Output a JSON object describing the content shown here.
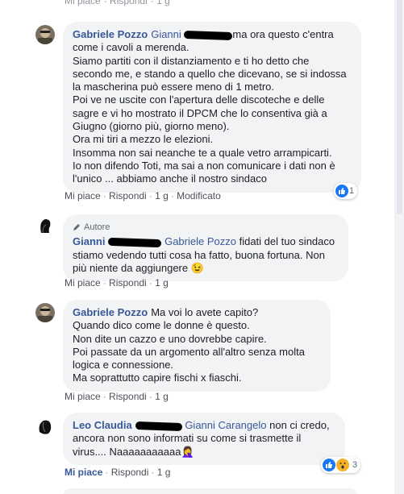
{
  "top": {
    "like": "Mi piace",
    "reply": "Rispondi",
    "time": "1 g"
  },
  "comments": [
    {
      "name": "Gabriele Pozzo",
      "mention": "Gianni",
      "text_after_mention": "ma ora questo c'entra come i cavoli a merenda.",
      "lines": [
        "Siamo partiti con il distanziamento e ti ho detto che secondo me, e stando a quello che dicevano, se si indossa la mascherina può essere meno di 1 metro.",
        "Poi ve ne uscite con l'apertura delle discoteche e delle sagre e vi ho mostrato il DPCM che lo consentiva già a Giugno (giorno più, giorno meno).",
        "Ora mi tiri a mezzo le elezioni.",
        "Insomma non sai neanche te a quale vetro arrampicarti.",
        "Io non difendo Toti, ma sai a non comunicare i dati non è l'unico ... abbiamo anche il nostro sindaco"
      ],
      "like": "Mi piace",
      "reply": "Rispondi",
      "time": "1 g",
      "edited": "Modificato",
      "reaction_count": "1"
    },
    {
      "author_tag": "Autore",
      "name": "Gianni",
      "mention": "Gabriele Pozzo",
      "text": "fidati del tuo sindaco stiamo vedendo tutti cosa ha fatto, buona fortuna. Non più niente da aggiungere",
      "emoji": "😉",
      "like": "Mi piace",
      "reply": "Rispondi",
      "time": "1 g"
    },
    {
      "name": "Gabriele Pozzo",
      "text_first": "Ma voi lo avete capito?",
      "lines": [
        "Quando dico come le donne è questo.",
        "Non dite un cazzo e uno dovrebbe capire.",
        "Poi passate da un argomento all'altro senza molta logica e connessione.",
        "Ma soprattutto capire fischi x fiaschi."
      ],
      "like": "Mi piace",
      "reply": "Rispondi",
      "time": "1 g"
    },
    {
      "name": "Leo Claudia",
      "mention": "Gianni Carangelo",
      "text": "non ci credo, ancora non sono informati su come si trasmette il virus.... Naaaaaaaaaaa",
      "emoji": "🤦‍♀️",
      "like": "Mi piace",
      "reply": "Rispondi",
      "time": "1 g",
      "reaction_count": "3"
    }
  ],
  "colors": {
    "link": "#385898",
    "bubble": "#f2f3f5",
    "meta": "#90949c",
    "like_blue": "#1877f2"
  }
}
